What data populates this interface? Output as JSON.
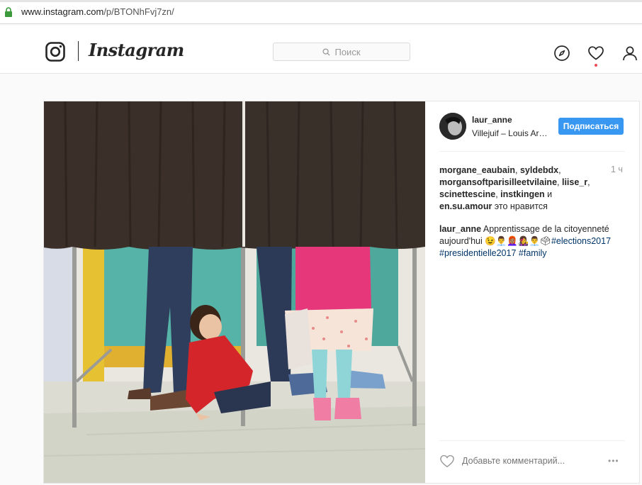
{
  "browser": {
    "url_host": "www.instagram.com",
    "url_path": "/p/BTONhFvj7zn/"
  },
  "header": {
    "wordmark": "Instagram",
    "search_placeholder": "Поиск",
    "icons": [
      "instagram-glyph-icon",
      "compass-icon",
      "heart-icon",
      "user-icon"
    ]
  },
  "post": {
    "author": "laur_anne",
    "location": "Villejuif – Louis Aragon",
    "follow_label": "Подписаться",
    "time": "1 ч",
    "likes": {
      "users": [
        "morgane_eaubain",
        "syldebdx",
        "morgansoftparisilleetvilaine",
        "liise_r",
        "scinettescine",
        "instkingen",
        "en.su.amour"
      ],
      "sep": ", ",
      "and": " и ",
      "suffix": " это нравится"
    },
    "caption": {
      "author": "laur_anne",
      "text": "Apprentissage de la citoyenneté aujourd'hui 😉👨‍💼👩🏽‍🦰👩‍🎤👨‍💼🗳",
      "tags": [
        "#elections2017",
        "#presidentielle2017",
        "#family"
      ]
    },
    "comment_placeholder": "Добавьте комментарий...",
    "more_label": "•••"
  },
  "colors": {
    "accent": "#3897f0",
    "hashtag": "#003569",
    "notification": "#ed4956"
  }
}
